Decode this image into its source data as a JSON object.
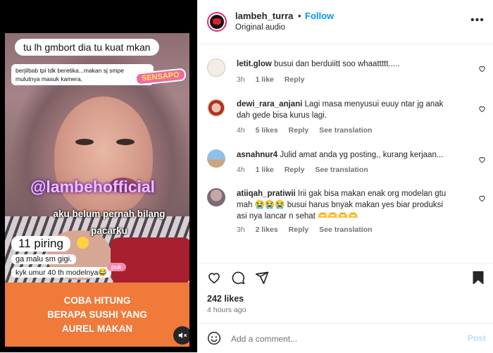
{
  "media": {
    "caption_top": "tu lh gmbort dia tu kuat mkan",
    "caption_small": "berjilbab tpi tdk beretika...makan sj smpe mulutnya masuk kamera,",
    "sticker": "SENSAPO",
    "watermark": "@lambehofficial",
    "caption_mid": "aku belum pernah bilang pacarku",
    "caption_piring": "11 piring",
    "caption_malu": "ga malu sm gigi.",
    "caption_umur": "kyk umur 40 th modelnya😂",
    "pink_tag": "puk",
    "banner": "COBA HITUNG\nBERAPA SUSHI YANG\nAUREL MAKAN"
  },
  "header": {
    "username": "lambeh_turra",
    "separator": "•",
    "follow": "Follow",
    "audio": "Original audio",
    "more": "•••"
  },
  "comments": [
    {
      "user": "letit.glow",
      "text": "busui dan berduiitt soo whaattttt.....",
      "time": "3h",
      "likes": "1 like",
      "reply": "Reply",
      "translate": ""
    },
    {
      "user": "dewi_rara_anjani",
      "text": "Lagi masa menyusui euuy ntar jg anak dah gede bisa kurus lagi.",
      "time": "4h",
      "likes": "5 likes",
      "reply": "Reply",
      "translate": "See translation"
    },
    {
      "user": "asnahnur4",
      "text": "Julid amat anda yg posting,, kurang kerjaan...",
      "time": "4h",
      "likes": "1 like",
      "reply": "Reply",
      "translate": "See translation"
    },
    {
      "user": "atiiqah_pratiwii",
      "text": "Irii gak bisa makan enak org modelan gtu mah 😭😭😭 busui harus bnyak makan yes biar produksi asi nya lancar n sehat 🫶🫶🫶🫶",
      "time": "3h",
      "likes": "2 likes",
      "reply": "Reply",
      "translate": "See translation"
    }
  ],
  "stats": {
    "likes": "242 likes",
    "time_ago": "4 hours ago"
  },
  "add_comment": {
    "placeholder": "Add a comment...",
    "post": "Post"
  },
  "colors": {
    "link_blue": "#0095f6",
    "banner_orange": "#f07a3a",
    "post_disabled": "#b2dffc"
  }
}
